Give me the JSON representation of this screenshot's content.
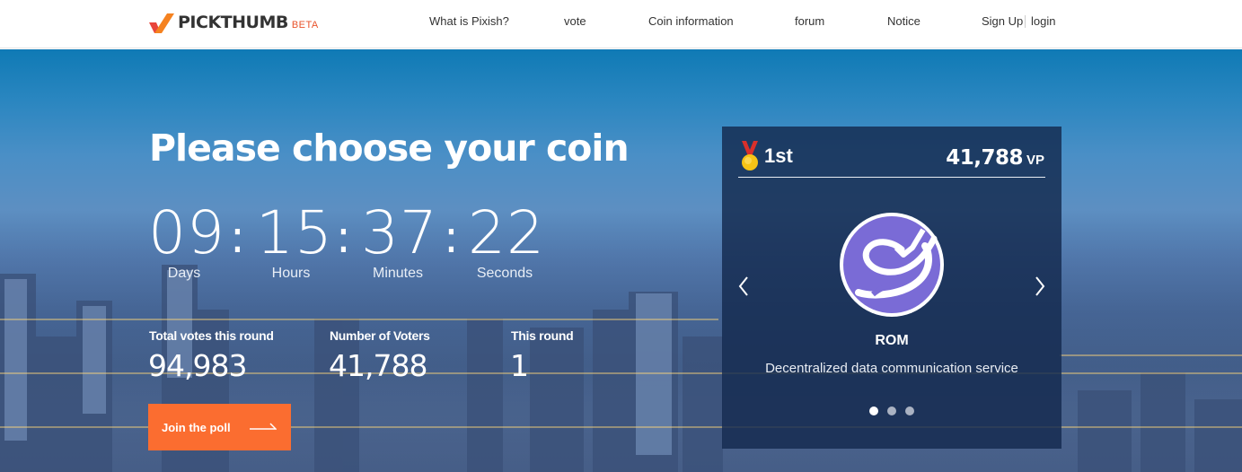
{
  "header": {
    "logo": {
      "name": "PICKTHUMB",
      "badge": "BETA",
      "icon": "checkmark-logo-icon",
      "colors": {
        "check_left": "#e8453c",
        "check_right": "#f58220",
        "text": "#333333"
      }
    },
    "nav": [
      {
        "label": "What is Pixish?"
      },
      {
        "label": "vote"
      },
      {
        "label": "Coin information"
      },
      {
        "label": "forum"
      },
      {
        "label": "Notice"
      }
    ],
    "auth": {
      "signup_label": "Sign Up",
      "login_label": "login"
    }
  },
  "hero": {
    "title": "Please choose your coin",
    "countdown": {
      "days": "09",
      "hours": "15",
      "minutes": "37",
      "seconds": "22",
      "separator": ":",
      "labels": {
        "days": "Days",
        "hours": "Hours",
        "minutes": "Minutes",
        "seconds": "Seconds"
      }
    },
    "stats": [
      {
        "label": "Total votes this round",
        "value": "94,983"
      },
      {
        "label": "Number of Voters",
        "value": "41,788"
      },
      {
        "label": "This round",
        "value": "1"
      }
    ],
    "join_button": {
      "label": "Join the poll",
      "icon": "arrow-right-icon",
      "color": "#fb6d30"
    }
  },
  "ranking": {
    "rank_label": "1st",
    "rank_icon": "gold-medal-icon",
    "points": "41,788",
    "points_unit": "VP",
    "coin": {
      "name": "ROM",
      "description": "Decentralized data communication service",
      "logo_icon": "rom-coin-logo-icon",
      "color": "#7a6bd6"
    },
    "carousel": {
      "prev_icon": "chevron-left-icon",
      "next_icon": "chevron-right-icon",
      "slide_count": 3,
      "active_slide": 1
    }
  }
}
